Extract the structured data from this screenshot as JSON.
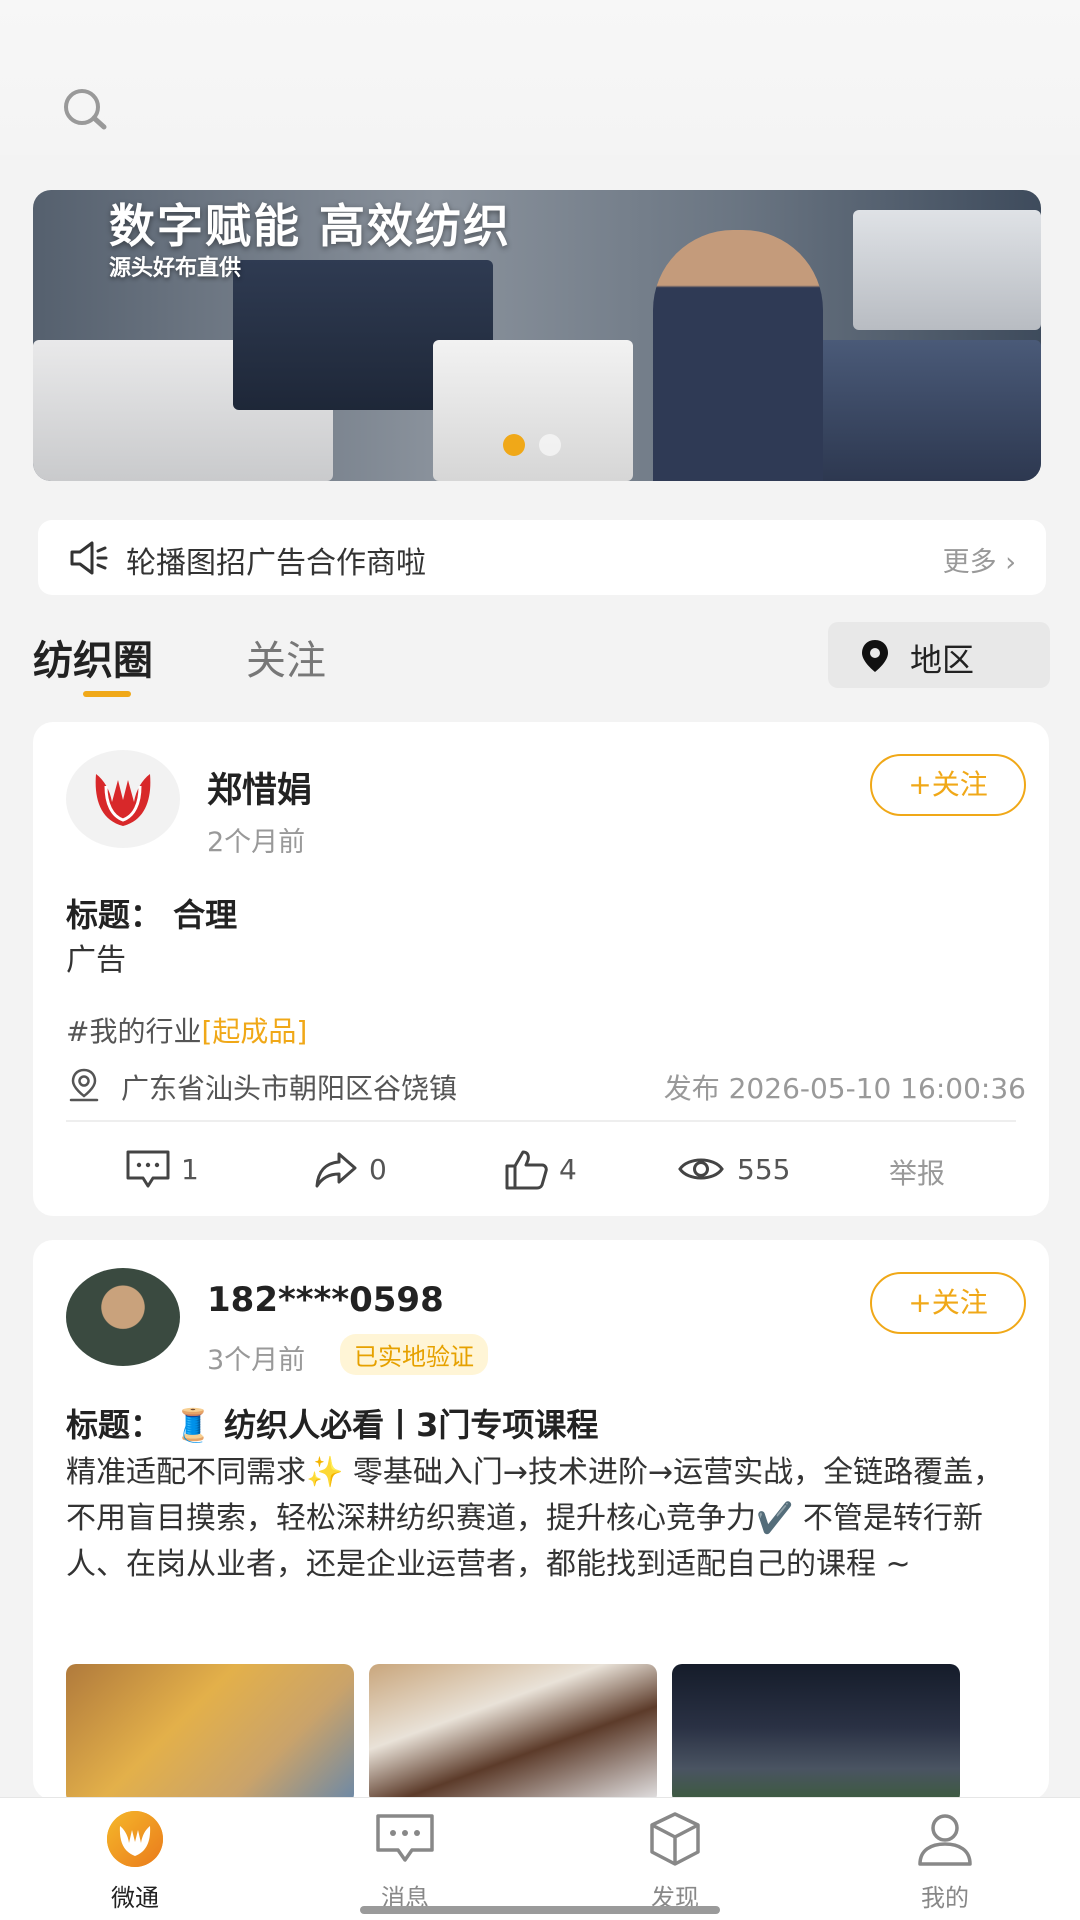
{
  "banner": {
    "title": "数字赋能 高效纺织",
    "subtitle": "源头好布直供"
  },
  "notice": {
    "text": "轮播图招广告合作商啦",
    "more": "更多"
  },
  "tabs": [
    {
      "label": "纺织圈",
      "active": true
    },
    {
      "label": "关注",
      "active": false
    }
  ],
  "region": {
    "label": "地区"
  },
  "posts": [
    {
      "author": "郑惜娟",
      "time": "2个月前",
      "follow": "+关注",
      "title": "标题： 合理",
      "body": "广告",
      "tag_prefix": "#我的行业",
      "tag_highlight": "[起成品]",
      "location": "广东省汕头市朝阳区谷饶镇",
      "published": "发布 2026-05-10 16:00:36",
      "comments": "1",
      "shares": "0",
      "likes": "4",
      "views": "555",
      "report": "举报"
    },
    {
      "author": "182****0598",
      "time": "3个月前",
      "badge": "已实地验证",
      "follow": "+关注",
      "title": "标题： 🧵 纺织人必看丨3门专项课程",
      "body": "精准适配不同需求✨ 零基础入门→技术进阶→运营实战，全链路覆盖，不用盲目摸索，轻松深耕纺织赛道，提升核心竞争力✔️ 不管是转行新人、在岗从业者，还是企业运营者，都能找到适配自己的课程 ~"
    }
  ],
  "bottom_nav": [
    {
      "label": "微通",
      "icon": "app-logo-icon",
      "active": true
    },
    {
      "label": "消息",
      "icon": "message-icon",
      "active": false
    },
    {
      "label": "发现",
      "icon": "cube-icon",
      "active": false
    },
    {
      "label": "我的",
      "icon": "user-icon",
      "active": false
    }
  ],
  "colors": {
    "accent": "#f0a818",
    "brand_logo": "#d8282a"
  }
}
